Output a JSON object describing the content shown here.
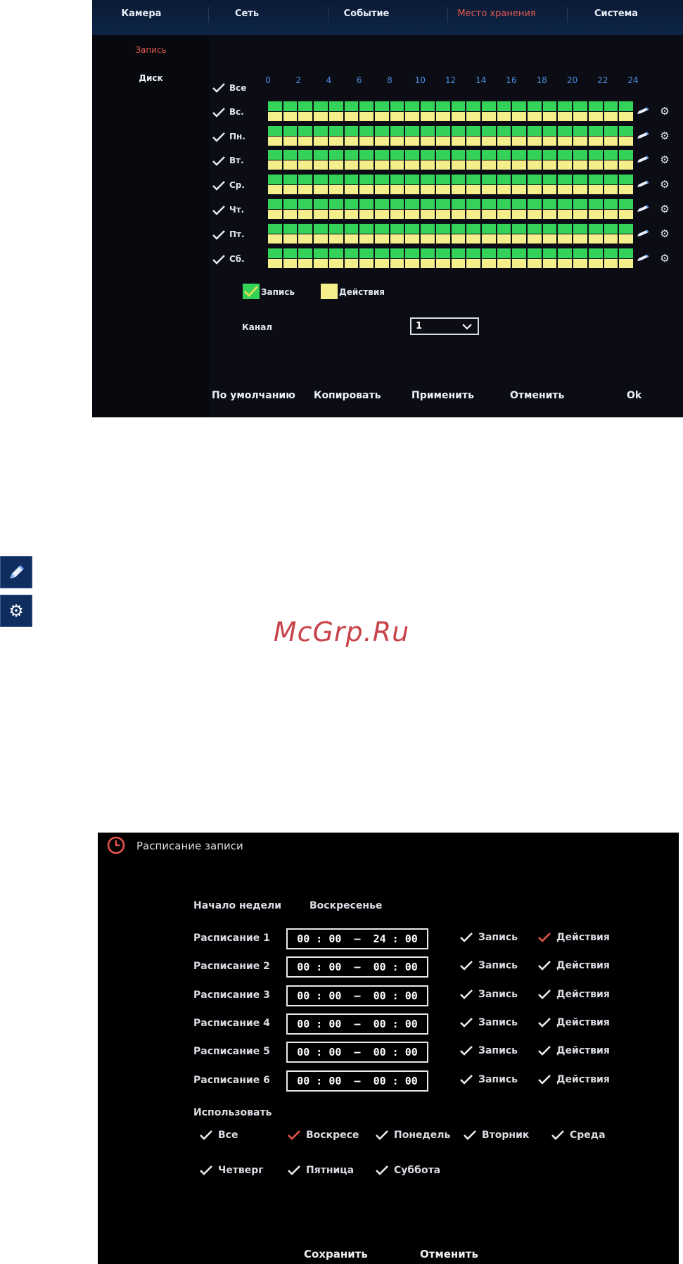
{
  "top_screen": {
    "tabs": [
      "Камера",
      "Сеть",
      "Событие",
      "Место хранения",
      "Система"
    ],
    "active_tab": "Место хранения",
    "side_menu": [
      "Запись",
      "Диск"
    ],
    "active_menu": "Запись",
    "hours": [
      "0",
      "2",
      "4",
      "6",
      "8",
      "10",
      "12",
      "14",
      "16",
      "18",
      "20",
      "22",
      "24"
    ],
    "all_label": "Все",
    "days": [
      "Вс.",
      "Пн.",
      "Вт.",
      "Ср.",
      "Чт.",
      "Пт.",
      "Сб."
    ],
    "legend": {
      "record": "Запись",
      "actions": "Действия"
    },
    "channel": {
      "label": "Канал",
      "value": "1"
    },
    "buttons": {
      "default": "По умолчанию",
      "copy": "Копировать",
      "apply": "Применить",
      "cancel": "Отменить",
      "ok": "Ok"
    },
    "colors": {
      "record_green": "#35d25a",
      "action_yellow": "#f4ef8a",
      "active_tab": "#e4584f",
      "hour_blue": "#4d8fe0"
    }
  },
  "side_icons": [
    "pencil-icon",
    "gear-icon"
  ],
  "watermark": "McGrp.Ru",
  "bottom_dialog": {
    "title": "Расписание записи",
    "week_start": {
      "label": "Начало недели",
      "value": "Воскресенье"
    },
    "schedules": [
      {
        "label": "Расписание 1",
        "time": "00 : 00  –  24 : 00",
        "record": "Запись",
        "actions": "Действия",
        "record_checked": true,
        "actions_checked": true
      },
      {
        "label": "Расписание 2",
        "time": "00 : 00  –  00 : 00",
        "record": "Запись",
        "actions": "Действия",
        "record_checked": true,
        "actions_checked": true
      },
      {
        "label": "Расписание 3",
        "time": "00 : 00  –  00 : 00",
        "record": "Запись",
        "actions": "Действия",
        "record_checked": true,
        "actions_checked": true
      },
      {
        "label": "Расписание 4",
        "time": "00 : 00  –  00 : 00",
        "record": "Запись",
        "actions": "Действия",
        "record_checked": true,
        "actions_checked": true
      },
      {
        "label": "Расписание 5",
        "time": "00 : 00  –  00 : 00",
        "record": "Запись",
        "actions": "Действия",
        "record_checked": true,
        "actions_checked": true
      },
      {
        "label": "Расписание 6",
        "time": "00 : 00  –  00 : 00",
        "record": "Запись",
        "actions": "Действия",
        "record_checked": true,
        "actions_checked": true
      }
    ],
    "use_label": "Использовать",
    "use_days": [
      "Все",
      "Воскресе",
      "Понедель",
      "Вторник",
      "Среда",
      "Четверг",
      "Пятница",
      "Суббота"
    ],
    "buttons": {
      "save": "Сохранить",
      "cancel": "Отменить"
    },
    "colors": {
      "accent_red": "#e4544c",
      "check_white": "#e8eaee"
    }
  }
}
